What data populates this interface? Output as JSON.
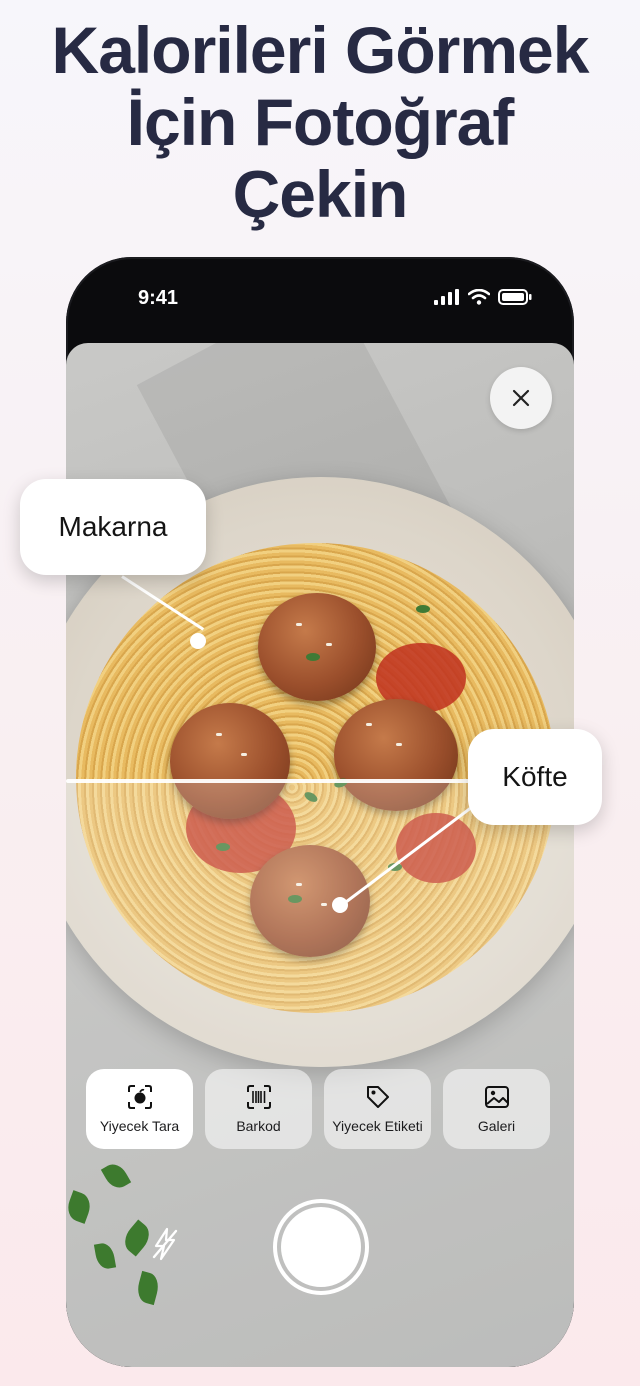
{
  "headline": {
    "line1": "Kalorileri Görmek",
    "line2": "İçin Fotoğraf",
    "line3": "Çekin"
  },
  "status_bar": {
    "time": "9:41",
    "icons": [
      "signal-icon",
      "wifi-icon",
      "battery-icon"
    ]
  },
  "camera": {
    "close_icon": "close-icon",
    "labels": [
      {
        "text": "Makarna"
      },
      {
        "text": "Köfte"
      }
    ],
    "modes": [
      {
        "label": "Yiyecek Tara",
        "icon": "scan-food-icon",
        "active": true
      },
      {
        "label": "Barkod",
        "icon": "barcode-icon",
        "active": false
      },
      {
        "label": "Yiyecek Etiketi",
        "icon": "tag-icon",
        "active": false
      },
      {
        "label": "Galeri",
        "icon": "gallery-icon",
        "active": false
      }
    ],
    "flash_icon": "flash-off-icon",
    "shutter_icon": "shutter-button"
  },
  "colors": {
    "headline": "#272a43",
    "background_top": "#f7f6fb",
    "background_bottom": "#fbe9ec",
    "phone_frame": "#0b0b0d"
  }
}
